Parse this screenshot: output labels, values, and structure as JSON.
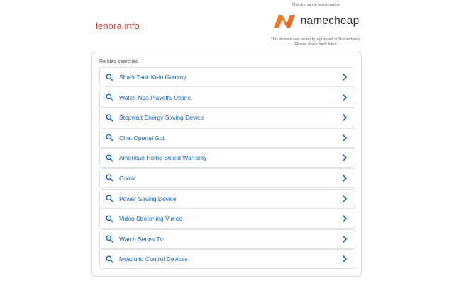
{
  "header": {
    "domain": "lenora.info"
  },
  "registrar": {
    "registered_text": "This domain is registered at",
    "brand_name": "namecheap",
    "brand_color": "#ff5a1f",
    "notice_line1": "This domain was recently registered at Namecheap.",
    "notice_line2": "Please check back later!"
  },
  "results": {
    "heading": "Related searches",
    "icon": "search-icon",
    "link_color": "#1565c0",
    "items": [
      {
        "label": "Shark Tank Keto Gummy"
      },
      {
        "label": "Watch Nba Playoffs Online"
      },
      {
        "label": "Stopwatt Energy Saving Device"
      },
      {
        "label": "Chat Openai Gpt"
      },
      {
        "label": "American Home Shield Warranty"
      },
      {
        "label": "Comic"
      },
      {
        "label": "Power Saving Device"
      },
      {
        "label": "Video Streaming Vimeo"
      },
      {
        "label": "Watch Series Tv"
      },
      {
        "label": "Mosquito Control Devices"
      }
    ]
  }
}
